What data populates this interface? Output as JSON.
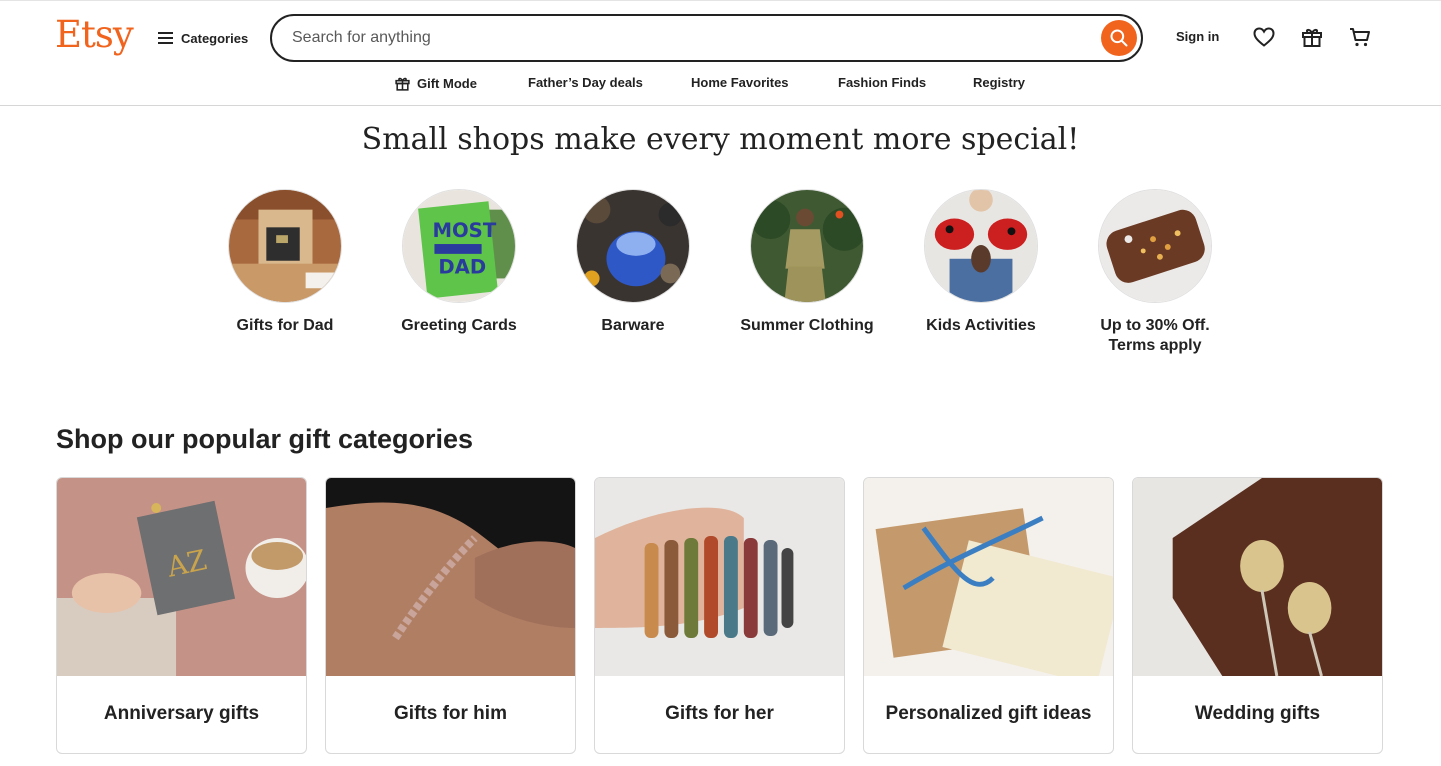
{
  "header": {
    "logo": "Etsy",
    "categories_label": "Categories",
    "search_placeholder": "Search for anything",
    "sign_in": "Sign in",
    "brand_color": "#F1641E"
  },
  "subnav": [
    {
      "label": "Gift Mode",
      "icon": "gift-icon"
    },
    {
      "label": "Father’s Day deals"
    },
    {
      "label": "Home Favorites"
    },
    {
      "label": "Fashion Finds"
    },
    {
      "label": "Registry"
    }
  ],
  "hero": {
    "title": "Small shops make every moment more special!",
    "items": [
      {
        "label": "Gifts for Dad"
      },
      {
        "label": "Greeting Cards"
      },
      {
        "label": "Barware"
      },
      {
        "label": "Summer Clothing"
      },
      {
        "label": "Kids Activities"
      },
      {
        "label": "Up to 30% Off. Terms apply"
      }
    ]
  },
  "popular": {
    "title": "Shop our popular gift categories",
    "cards": [
      {
        "label": "Anniversary gifts"
      },
      {
        "label": "Gifts for him"
      },
      {
        "label": "Gifts for her"
      },
      {
        "label": "Personalized gift ideas"
      },
      {
        "label": "Wedding gifts"
      }
    ]
  }
}
